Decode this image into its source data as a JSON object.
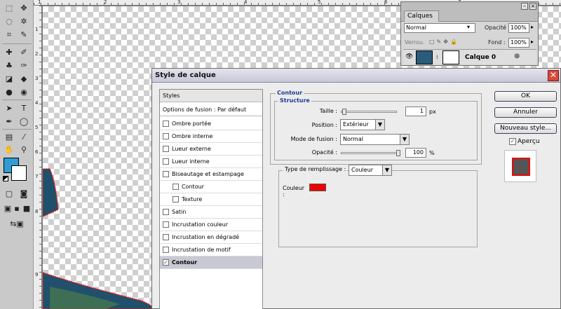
{
  "layers_panel": {
    "tab": "Calques",
    "blend_mode": "Normal",
    "opacity_label": "Opacité :",
    "opacity_value": "100%",
    "lock_label": "Verrou.",
    "fill_label": "Fond :",
    "fill_value": "100%",
    "layer_name": "Calque 0"
  },
  "ruler": {
    "top_numbers": [
      "1",
      "2",
      "3",
      "4",
      "5",
      "6",
      "7"
    ],
    "left_numbers": [
      "1",
      "2",
      "3",
      "4",
      "5",
      "6",
      "7",
      "8",
      "9"
    ]
  },
  "dialog": {
    "title": "Style de calque",
    "close": "✕",
    "styles_header": "Styles",
    "blend_options": "Options de fusion : Par défaut",
    "style_items": [
      {
        "label": "Ombre portée",
        "checked": false,
        "sub": false,
        "selected": false
      },
      {
        "label": "Ombre interne",
        "checked": false,
        "sub": false,
        "selected": false
      },
      {
        "label": "Lueur externe",
        "checked": false,
        "sub": false,
        "selected": false
      },
      {
        "label": "Lueur interne",
        "checked": false,
        "sub": false,
        "selected": false
      },
      {
        "label": "Biseautage et estampage",
        "checked": false,
        "sub": false,
        "selected": false
      },
      {
        "label": "Contour",
        "checked": false,
        "sub": true,
        "selected": false
      },
      {
        "label": "Texture",
        "checked": false,
        "sub": true,
        "selected": false
      },
      {
        "label": "Satin",
        "checked": false,
        "sub": false,
        "selected": false
      },
      {
        "label": "Incrustation couleur",
        "checked": false,
        "sub": false,
        "selected": false
      },
      {
        "label": "Incrustation en dégradé",
        "checked": false,
        "sub": false,
        "selected": false
      },
      {
        "label": "Incrustation de motif",
        "checked": false,
        "sub": false,
        "selected": false
      },
      {
        "label": "Contour",
        "checked": true,
        "sub": false,
        "selected": true
      }
    ],
    "section_title": "Contour",
    "structure_title": "Structure",
    "size_label": "Taille :",
    "size_value": "1",
    "size_unit": "px",
    "size_slider": 0.01,
    "position_label": "Position :",
    "position_value": "Extérieur",
    "blend_mode_label": "Mode de fusion :",
    "blend_mode_value": "Normal",
    "opacity_label": "Opacité :",
    "opacity_value": "100",
    "opacity_unit": "%",
    "opacity_slider": 1.0,
    "fill_type_label": "Type de remplissage :",
    "fill_type_value": "Couleur",
    "color_label": "Couleur :",
    "stroke_color": "#ee0000",
    "ok": "OK",
    "cancel": "Annuler",
    "new_style": "Nouveau style...",
    "preview_label": "Aperçu",
    "preview_checked": true
  }
}
